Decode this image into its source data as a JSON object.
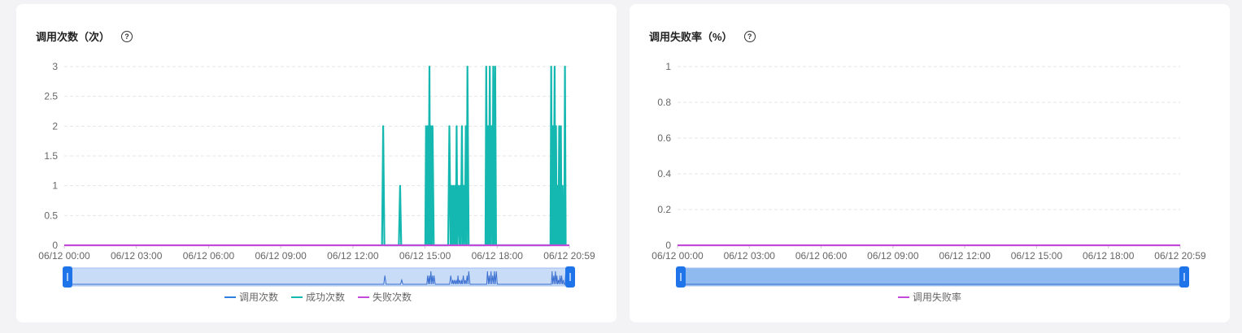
{
  "colors": {
    "calls": "#2f7fe0",
    "success": "#15b8b0",
    "fail": "#c14bd8",
    "fail_rate": "#c14bd8",
    "grid": "#e6e6e6",
    "axis_text": "#666666"
  },
  "left_panel": {
    "title": "调用次数（次）",
    "help_icon": "question-circle-icon",
    "legend": [
      {
        "label": "调用次数",
        "color": "#2f7fe0"
      },
      {
        "label": "成功次数",
        "color": "#15b8b0"
      },
      {
        "label": "失败次数",
        "color": "#c14bd8"
      }
    ]
  },
  "right_panel": {
    "title": "调用失败率（%）",
    "help_icon": "question-circle-icon",
    "legend": [
      {
        "label": "调用失败率",
        "color": "#c14bd8"
      }
    ]
  },
  "chart_data": [
    {
      "type": "line",
      "title": "调用次数（次）",
      "x_range_hours": [
        0,
        20.983
      ],
      "x_tick_labels": [
        "06/12 00:00",
        "06/12 03:00",
        "06/12 06:00",
        "06/12 09:00",
        "06/12 12:00",
        "06/12 15:00",
        "06/12 18:00",
        "06/12 20:59"
      ],
      "y_ticks": [
        0,
        0.5,
        1,
        1.5,
        2,
        2.5,
        3
      ],
      "ylim": [
        0,
        3
      ],
      "grid": true,
      "legend_position": "bottom",
      "series": [
        {
          "name": "成功次数",
          "points": [
            [
              13.2,
              0
            ],
            [
              13.25,
              2
            ],
            [
              13.3,
              0
            ],
            [
              13.9,
              0
            ],
            [
              13.95,
              1
            ],
            [
              14.0,
              0
            ],
            [
              15.0,
              0
            ],
            [
              15.03,
              2
            ],
            [
              15.07,
              0
            ],
            [
              15.1,
              2
            ],
            [
              15.13,
              0
            ],
            [
              15.17,
              3
            ],
            [
              15.2,
              0
            ],
            [
              15.23,
              2
            ],
            [
              15.27,
              0
            ],
            [
              15.3,
              2
            ],
            [
              15.35,
              0
            ],
            [
              15.95,
              0
            ],
            [
              16.0,
              2
            ],
            [
              16.05,
              0
            ],
            [
              16.08,
              1
            ],
            [
              16.12,
              0
            ],
            [
              16.15,
              1
            ],
            [
              16.2,
              0
            ],
            [
              16.23,
              1
            ],
            [
              16.27,
              0
            ],
            [
              16.3,
              2
            ],
            [
              16.33,
              0
            ],
            [
              16.37,
              1
            ],
            [
              16.42,
              0
            ],
            [
              16.45,
              1
            ],
            [
              16.48,
              0
            ],
            [
              16.52,
              2
            ],
            [
              16.56,
              0
            ],
            [
              16.6,
              1
            ],
            [
              16.64,
              0
            ],
            [
              16.68,
              2
            ],
            [
              16.72,
              0
            ],
            [
              16.75,
              3
            ],
            [
              16.8,
              0
            ],
            [
              17.5,
              0
            ],
            [
              17.53,
              3
            ],
            [
              17.57,
              0
            ],
            [
              17.6,
              2
            ],
            [
              17.64,
              0
            ],
            [
              17.68,
              3
            ],
            [
              17.71,
              0
            ],
            [
              17.75,
              2
            ],
            [
              17.79,
              0
            ],
            [
              17.82,
              3
            ],
            [
              17.86,
              0
            ],
            [
              17.9,
              3
            ],
            [
              17.94,
              0
            ],
            [
              20.2,
              0
            ],
            [
              20.23,
              3
            ],
            [
              20.26,
              0
            ],
            [
              20.3,
              2
            ],
            [
              20.33,
              0
            ],
            [
              20.37,
              3
            ],
            [
              20.4,
              0
            ],
            [
              20.43,
              2
            ],
            [
              20.46,
              0
            ],
            [
              20.5,
              1
            ],
            [
              20.53,
              0
            ],
            [
              20.56,
              2
            ],
            [
              20.6,
              0
            ],
            [
              20.63,
              2
            ],
            [
              20.66,
              0
            ],
            [
              20.7,
              1
            ],
            [
              20.73,
              0
            ],
            [
              20.77,
              0
            ],
            [
              20.8,
              3
            ],
            [
              20.83,
              0
            ]
          ]
        },
        {
          "name": "失败次数",
          "points": [
            [
              0,
              0
            ],
            [
              20.983,
              0
            ]
          ]
        }
      ],
      "brush_range": [
        0,
        1
      ]
    },
    {
      "type": "line",
      "title": "调用失败率（%）",
      "x_range_hours": [
        0,
        20.983
      ],
      "x_tick_labels": [
        "06/12 00:00",
        "06/12 03:00",
        "06/12 06:00",
        "06/12 09:00",
        "06/12 12:00",
        "06/12 15:00",
        "06/12 18:00",
        "06/12 20:59"
      ],
      "y_ticks": [
        0,
        0.2,
        0.4,
        0.6,
        0.8,
        1
      ],
      "ylim": [
        0,
        1
      ],
      "grid": true,
      "legend_position": "bottom",
      "series": [
        {
          "name": "调用失败率",
          "points": [
            [
              0,
              0
            ],
            [
              20.983,
              0
            ]
          ]
        }
      ],
      "brush_range": [
        0,
        1
      ]
    }
  ]
}
